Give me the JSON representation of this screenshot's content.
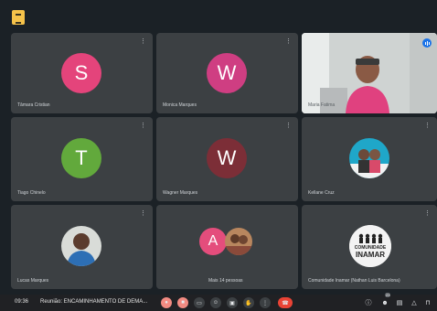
{
  "toolbar": {
    "app_icon": "document-icon"
  },
  "participants": [
    {
      "name": "Tâmara Cristian",
      "initial": "S",
      "color": "#e4447b",
      "type": "initial"
    },
    {
      "name": "Monica Marques",
      "initial": "W",
      "color": "#cf3e82",
      "type": "initial"
    },
    {
      "name": "Maria Fatima",
      "type": "video"
    },
    {
      "name": "Tiago Chinelo",
      "initial": "T",
      "color": "#62a93c",
      "type": "initial"
    },
    {
      "name": "Wagner Marques",
      "initial": "W",
      "color": "#7c2e37",
      "type": "initial"
    },
    {
      "name": "Kellane Cruz",
      "type": "photo"
    },
    {
      "name": "Lucas Marques",
      "type": "photo"
    },
    {
      "name": "Mais 14 pessoas",
      "initial": "A",
      "color": "#e44d7c",
      "type": "group"
    },
    {
      "name": "Comunidade Inamar (Nathan Luis Barcelona)",
      "logo_line1": "COMUNIDADE",
      "logo_line2": "INAMAR",
      "type": "logo"
    }
  ],
  "bottom_bar": {
    "time": "09:36",
    "title": "Reunião: ENCAMINHAMENTO DE DEMA...",
    "controls": [
      "mic-icon",
      "camera-icon",
      "captions-icon",
      "emoji-icon",
      "present-icon",
      "raise-hand-icon",
      "more-options-icon",
      "end-call-icon"
    ],
    "right_controls": [
      "info-icon",
      "people-icon",
      "chat-icon",
      "activities-icon",
      "lock-icon"
    ],
    "people_count": "23"
  },
  "colors": {
    "background": "#1b2126",
    "tile": "#3c4043",
    "end_call": "#ea4335"
  }
}
